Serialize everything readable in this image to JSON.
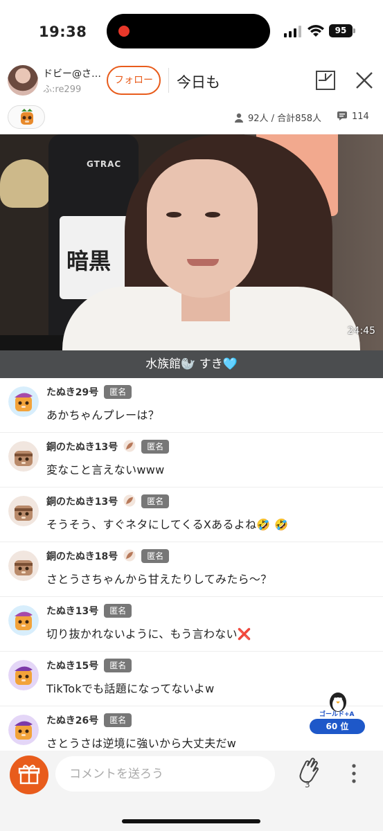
{
  "status_bar": {
    "time": "19:38",
    "battery": "95"
  },
  "header": {
    "streamer_name": "ドビー@さ…",
    "streamer_id": "ふ:re299",
    "follow_label": "フォロー",
    "live_title": "今日も"
  },
  "stats": {
    "viewers": "92人 / 合計858人",
    "comments": "114"
  },
  "video": {
    "elapsed": "24:45",
    "caption": "水族館🦭 すき🩵",
    "overlay_text": "暗黒",
    "chair_brand": "GTRAC"
  },
  "comments": [
    {
      "name": "たぬき29号",
      "badge": "匿名",
      "text": "あかちゃんプレーは？"
    },
    {
      "name": "銅のたぬき13号",
      "badge": "匿名",
      "text": "変なこと言えないwww"
    },
    {
      "name": "銅のたぬき13号",
      "badge": "匿名",
      "text": "そうそう、すぐネタにしてくるXあるよね🤣 🤣"
    },
    {
      "name": "銅のたぬき18号",
      "badge": "匿名",
      "text": "さとうさちゃんから甘えたりしてみたら〜？"
    },
    {
      "name": "たぬき13号",
      "badge": "匿名",
      "text": "切り抜かれないように、もう言わない❌"
    },
    {
      "name": "たぬき15号",
      "badge": "匿名",
      "text": "TikTokでも話題になってないよw"
    },
    {
      "name": "たぬき26号",
      "badge": "匿名",
      "text": "さとうさは逆境に強いから大丈夫だw"
    }
  ],
  "rank": {
    "label": "ゴールド+A",
    "position": "60 位"
  },
  "bottom": {
    "comment_placeholder": "コメントを送ろう",
    "clap_count": "3"
  },
  "colors": {
    "accent": "#e85c1c",
    "rank_blue": "#1e58c9",
    "anon_badge": "#777777"
  }
}
